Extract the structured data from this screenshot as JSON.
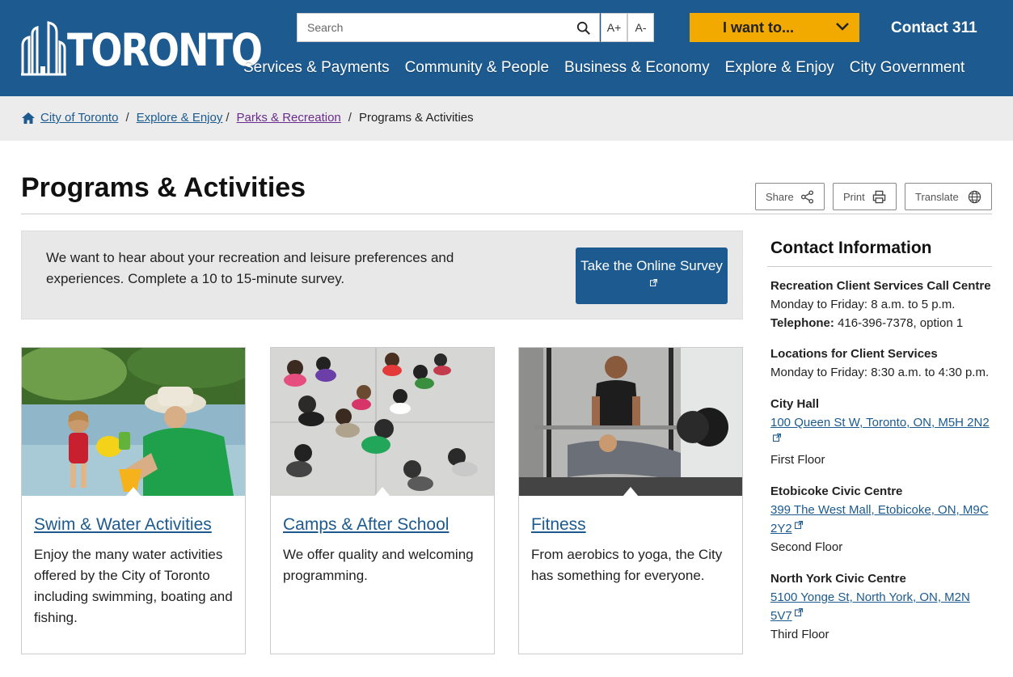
{
  "header": {
    "logo_text": "TORONTO",
    "search_placeholder": "Search",
    "font_increase": "A+",
    "font_decrease": "A-",
    "i_want_to": "I want to...",
    "contact_311": "Contact 311",
    "nav": [
      "Services & Payments",
      "Community & People",
      "Business & Economy",
      "Explore & Enjoy",
      "City Government"
    ]
  },
  "breadcrumb": {
    "items": [
      "City of Toronto",
      "Explore & Enjoy",
      "Parks & Recreation"
    ],
    "current": "Programs & Activities",
    "separator": "/"
  },
  "page": {
    "title": "Programs & Activities",
    "share": "Share",
    "print": "Print",
    "translate": "Translate"
  },
  "banner": {
    "text": "We want to hear about your recreation and leisure preferences and experiences. Complete a 10 to 15-minute survey.",
    "button": "Take the Online Survey"
  },
  "cards": [
    {
      "title": "Swim & Water Activities",
      "text": "Enjoy the many water activities offered by the City of Toronto including swimming, boating and fishing."
    },
    {
      "title": "Camps & After School",
      "text": "We offer quality and welcoming programming."
    },
    {
      "title": "Fitness",
      "text": "From aerobics to yoga, the City has something for everyone."
    }
  ],
  "sidebar": {
    "title": "Contact Information",
    "call_centre": {
      "name": "Recreation Client Services Call Centre",
      "hours": "Monday to Friday: 8 a.m. to 5 p.m.",
      "tel_label": "Telephone:",
      "tel": "416-396-7378, option 1"
    },
    "locations": {
      "name": "Locations for Client Services",
      "hours": "Monday to Friday: 8:30 a.m. to 4:30 p.m."
    },
    "offices": [
      {
        "name": "City Hall",
        "address": "100 Queen St W, Toronto, ON, M5H 2N2",
        "floor": "First Floor"
      },
      {
        "name": "Etobicoke Civic Centre",
        "address": "399 The West Mall, Etobicoke, ON, M9C 2Y2",
        "floor": "Second Floor"
      },
      {
        "name": "North York Civic Centre",
        "address": "5100 Yonge St, North York, ON, M2N 5V7",
        "floor": "Third Floor"
      }
    ]
  },
  "colors": {
    "brand_blue": "#1c5a8f",
    "accent_gold": "#f2a900",
    "breadcrumb_bg": "#ececec"
  }
}
